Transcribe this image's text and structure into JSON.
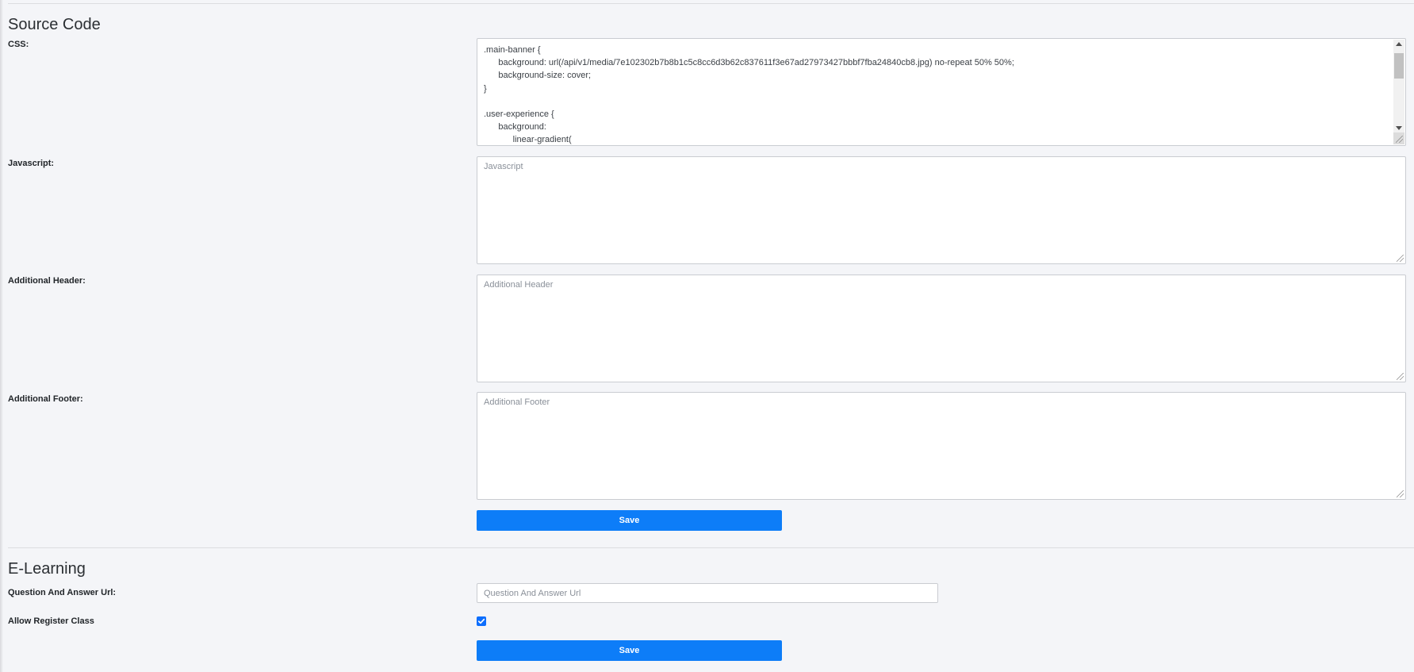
{
  "source_code": {
    "title": "Source Code",
    "css": {
      "label": "CSS:",
      "lines": [
        ".main-banner {",
        "      background: url(/api/v1/media/7e102302b7b8b1c5c8cc6d3b62c837611f3e67ad27973427bbbf7fba24840cb8.jpg) no-repeat 50% 50%;",
        "      background-size: cover;",
        "}",
        "",
        ".user-experience {",
        "      background:",
        "            linear-gradient("
      ]
    },
    "javascript": {
      "label": "Javascript:",
      "placeholder": "Javascript"
    },
    "additional_header": {
      "label": "Additional Header:",
      "placeholder": "Additional Header"
    },
    "additional_footer": {
      "label": "Additional Footer:",
      "placeholder": "Additional Footer"
    },
    "save_label": "Save"
  },
  "e_learning": {
    "title": "E-Learning",
    "qa_url": {
      "label": "Question And Answer Url:",
      "placeholder": "Question And Answer Url"
    },
    "allow_register": {
      "label": "Allow Register Class",
      "checked": true
    },
    "save_label": "Save"
  },
  "colors": {
    "primary": "#0d7df8",
    "background": "#f4f5f8"
  }
}
